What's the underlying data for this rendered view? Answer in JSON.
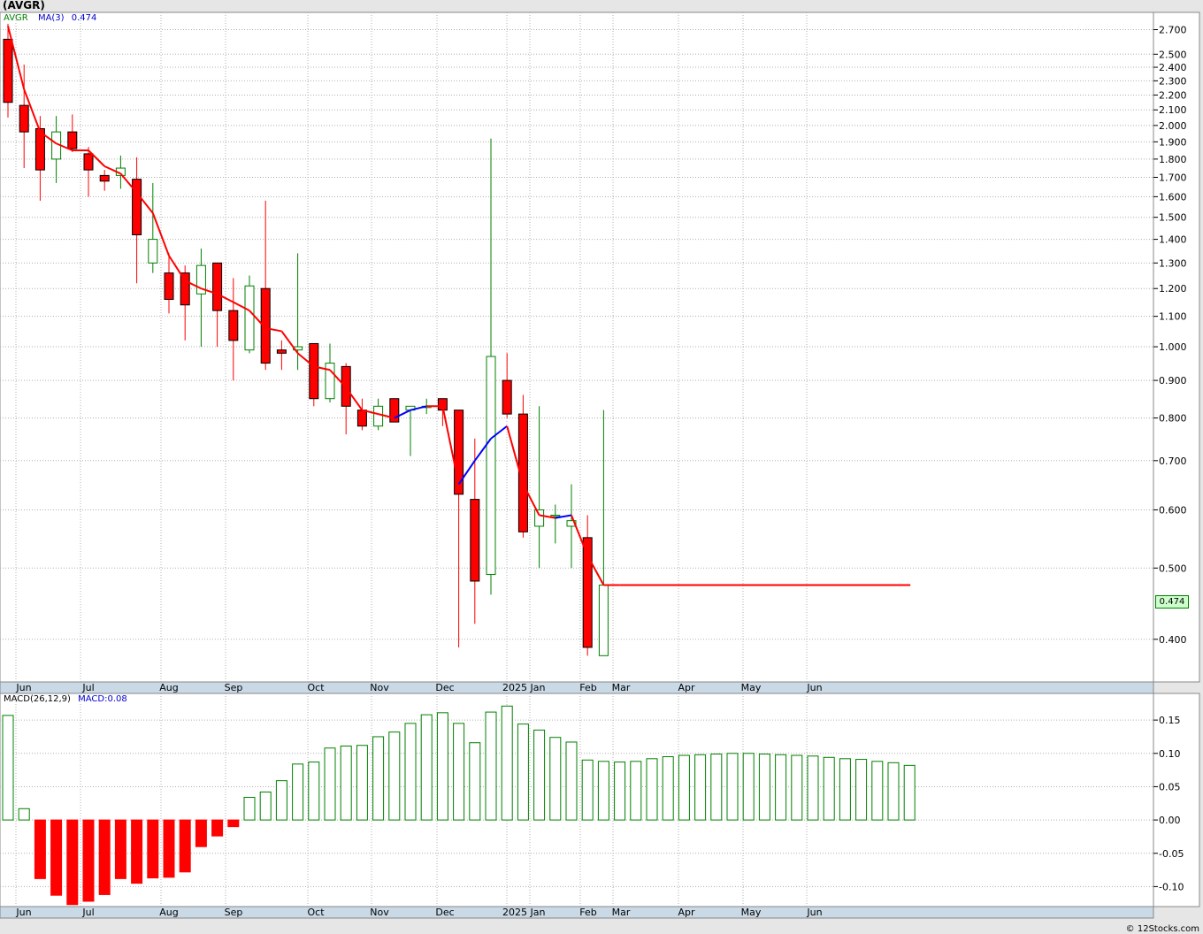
{
  "title": "(AVGR)",
  "legend_top": {
    "symbol": "AVGR",
    "ma_label": "MA(3)",
    "ma_value": "0.474"
  },
  "legend_bottom": {
    "macd_label": "MACD(26,12,9)",
    "macd_value": "MACD:0.08"
  },
  "last_price_tag": "0.474",
  "credit": "© 12Stocks.com",
  "colors": {
    "down": "#ff0000",
    "up": "#008000",
    "ma_down": "#ff0000",
    "ma_up": "#0000ff",
    "grid": "#b0b0b0",
    "axis_band": "#c9d9e6"
  },
  "chart_data": [
    {
      "type": "candlestick",
      "title": "(AVGR)",
      "scale": "log",
      "ylim": [
        0.35,
        2.85
      ],
      "y_ticks": [
        "0.400",
        "0.500",
        "0.600",
        "0.700",
        "0.800",
        "0.900",
        "1.000",
        "1.100",
        "1.200",
        "1.300",
        "1.400",
        "1.500",
        "1.600",
        "1.700",
        "1.800",
        "1.900",
        "2.000",
        "2.100",
        "2.200",
        "2.300",
        "2.400",
        "2.500",
        "2.700"
      ],
      "x_labels": [
        "Jun",
        "Jul",
        "Aug",
        "Sep",
        "Oct",
        "Nov",
        "Dec",
        "2025",
        "Jan",
        "Feb",
        "Mar",
        "Apr",
        "May",
        "Jun"
      ],
      "candles": [
        {
          "o": 2.62,
          "h": 2.75,
          "l": 2.05,
          "c": 2.15
        },
        {
          "o": 2.13,
          "h": 2.42,
          "l": 1.75,
          "c": 1.96
        },
        {
          "o": 1.98,
          "h": 2.06,
          "l": 1.58,
          "c": 1.74
        },
        {
          "o": 1.8,
          "h": 2.06,
          "l": 1.67,
          "c": 1.96
        },
        {
          "o": 1.96,
          "h": 2.07,
          "l": 1.84,
          "c": 1.86
        },
        {
          "o": 1.83,
          "h": 1.87,
          "l": 1.6,
          "c": 1.74
        },
        {
          "o": 1.71,
          "h": 1.74,
          "l": 1.63,
          "c": 1.68
        },
        {
          "o": 1.71,
          "h": 1.82,
          "l": 1.64,
          "c": 1.75
        },
        {
          "o": 1.69,
          "h": 1.81,
          "l": 1.22,
          "c": 1.42
        },
        {
          "o": 1.3,
          "h": 1.67,
          "l": 1.26,
          "c": 1.4
        },
        {
          "o": 1.26,
          "h": 1.34,
          "l": 1.11,
          "c": 1.16
        },
        {
          "o": 1.26,
          "h": 1.29,
          "l": 1.02,
          "c": 1.14
        },
        {
          "o": 1.18,
          "h": 1.36,
          "l": 1.0,
          "c": 1.29
        },
        {
          "o": 1.3,
          "h": 1.3,
          "l": 1.0,
          "c": 1.12
        },
        {
          "o": 1.12,
          "h": 1.24,
          "l": 0.9,
          "c": 1.02
        },
        {
          "o": 0.99,
          "h": 1.25,
          "l": 0.98,
          "c": 1.21
        },
        {
          "o": 1.2,
          "h": 1.58,
          "l": 0.93,
          "c": 0.95
        },
        {
          "o": 0.99,
          "h": 1.02,
          "l": 0.93,
          "c": 0.98
        },
        {
          "o": 0.99,
          "h": 1.34,
          "l": 0.93,
          "c": 1.0
        },
        {
          "o": 1.01,
          "h": 1.01,
          "l": 0.83,
          "c": 0.85
        },
        {
          "o": 0.85,
          "h": 1.01,
          "l": 0.84,
          "c": 0.95
        },
        {
          "o": 0.94,
          "h": 0.95,
          "l": 0.76,
          "c": 0.83
        },
        {
          "o": 0.82,
          "h": 0.85,
          "l": 0.77,
          "c": 0.78
        },
        {
          "o": 0.78,
          "h": 0.85,
          "l": 0.77,
          "c": 0.83
        },
        {
          "o": 0.85,
          "h": 0.85,
          "l": 0.79,
          "c": 0.79
        },
        {
          "o": 0.82,
          "h": 0.83,
          "l": 0.71,
          "c": 0.83
        },
        {
          "o": 0.83,
          "h": 0.85,
          "l": 0.81,
          "c": 0.83
        },
        {
          "o": 0.85,
          "h": 0.85,
          "l": 0.78,
          "c": 0.82
        },
        {
          "o": 0.82,
          "h": 0.82,
          "l": 0.39,
          "c": 0.63
        },
        {
          "o": 0.62,
          "h": 0.75,
          "l": 0.42,
          "c": 0.48
        },
        {
          "o": 0.49,
          "h": 1.92,
          "l": 0.46,
          "c": 0.97
        },
        {
          "o": 0.9,
          "h": 0.98,
          "l": 0.8,
          "c": 0.81
        },
        {
          "o": 0.81,
          "h": 0.86,
          "l": 0.55,
          "c": 0.56
        },
        {
          "o": 0.57,
          "h": 0.83,
          "l": 0.5,
          "c": 0.6
        },
        {
          "o": 0.59,
          "h": 0.61,
          "l": 0.54,
          "c": 0.59
        },
        {
          "o": 0.57,
          "h": 0.65,
          "l": 0.5,
          "c": 0.58
        },
        {
          "o": 0.55,
          "h": 0.59,
          "l": 0.38,
          "c": 0.39
        },
        {
          "o": 0.38,
          "h": 0.82,
          "l": 0.38,
          "c": 0.474
        }
      ],
      "ma3": [
        2.73,
        2.24,
        1.96,
        1.89,
        1.85,
        1.85,
        1.76,
        1.72,
        1.62,
        1.52,
        1.33,
        1.23,
        1.2,
        1.18,
        1.15,
        1.12,
        1.06,
        1.05,
        0.98,
        0.94,
        0.93,
        0.88,
        0.82,
        0.81,
        0.8,
        0.82,
        0.83,
        0.83,
        0.65,
        0.7,
        0.75,
        0.78,
        0.65,
        0.59,
        0.585,
        0.59,
        0.52,
        0.474,
        0.474
      ],
      "ma3_flat_until_index": 56
    },
    {
      "type": "bar",
      "title": "MACD(26,12,9)",
      "ylim": [
        -0.13,
        0.19
      ],
      "y_ticks": [
        "0.15",
        "0.10",
        "0.05",
        "0.00",
        "-0.05",
        "-0.10"
      ],
      "x_labels": [
        "Jun",
        "Jul",
        "Aug",
        "Sep",
        "Oct",
        "Nov",
        "Dec",
        "2025",
        "Jan",
        "Feb",
        "Mar",
        "Apr",
        "May",
        "Jun"
      ],
      "values": [
        0.157,
        0.017,
        -0.088,
        -0.113,
        -0.127,
        -0.122,
        -0.112,
        -0.088,
        -0.095,
        -0.087,
        -0.086,
        -0.078,
        -0.04,
        -0.024,
        -0.01,
        0.034,
        0.042,
        0.059,
        0.084,
        0.087,
        0.108,
        0.111,
        0.112,
        0.125,
        0.132,
        0.145,
        0.158,
        0.161,
        0.145,
        0.116,
        0.162,
        0.171,
        0.144,
        0.135,
        0.124,
        0.117,
        0.09,
        0.088,
        0.087,
        0.088,
        0.092,
        0.095,
        0.097,
        0.098,
        0.099,
        0.1,
        0.1,
        0.099,
        0.098,
        0.097,
        0.096,
        0.094,
        0.092,
        0.091,
        0.088,
        0.086,
        0.082
      ]
    }
  ]
}
